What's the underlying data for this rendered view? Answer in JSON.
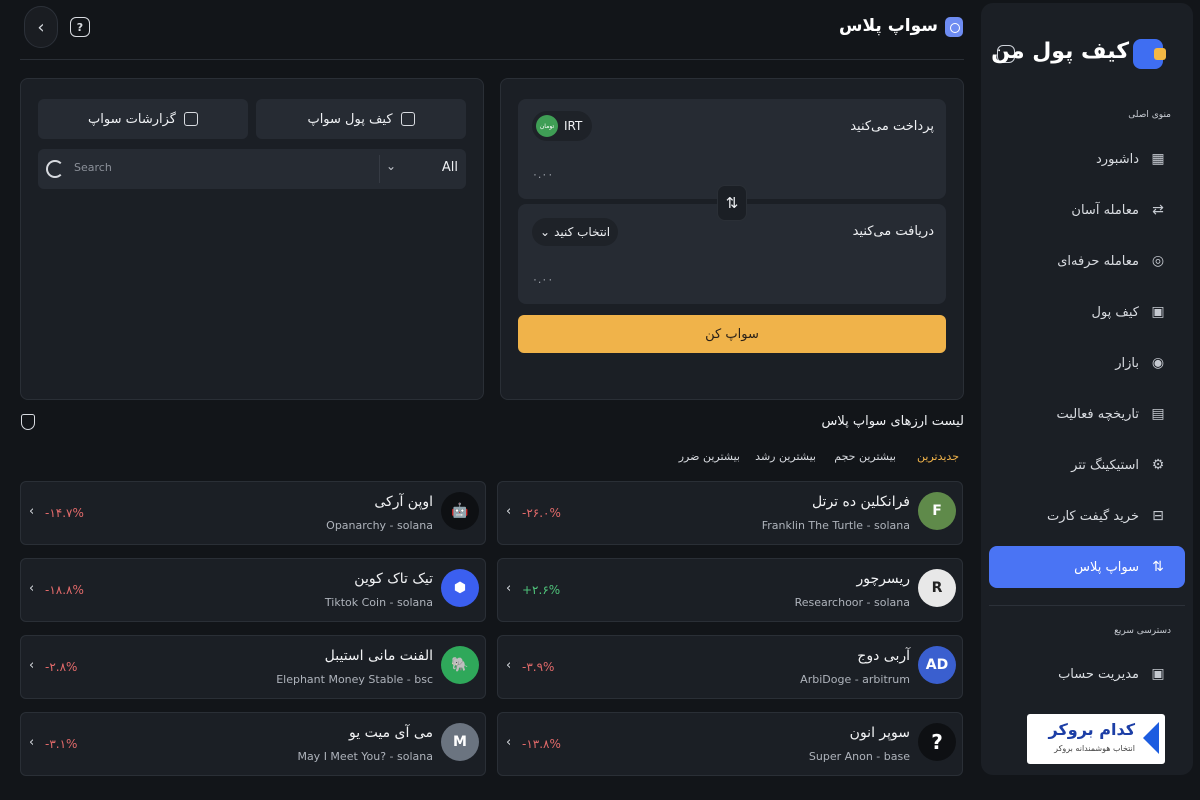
{
  "header": {
    "title": "سواپ پلاس",
    "back_icon": "chevron-left-icon",
    "help_icon": "help-chat-icon"
  },
  "sidebar": {
    "logo": "کیف پول من",
    "main_menu_title": "منوی اصلی",
    "items": [
      {
        "label": "داشبورد",
        "icon": "dashboard-grid-icon",
        "active": false
      },
      {
        "label": "معامله آسان",
        "icon": "easy-trade-icon",
        "active": false
      },
      {
        "label": "معامله حرفه‌ای",
        "icon": "pro-trade-icon",
        "active": false
      },
      {
        "label": "کیف پول",
        "icon": "wallet-icon",
        "active": false
      },
      {
        "label": "بازار",
        "icon": "market-icon",
        "active": false
      },
      {
        "label": "تاریخچه فعالیت",
        "icon": "history-icon",
        "active": false
      },
      {
        "label": "استیکینگ تتر",
        "icon": "staking-icon",
        "active": false
      },
      {
        "label": "خرید گیفت کارت",
        "icon": "gift-card-icon",
        "active": false
      },
      {
        "label": "سواپ پلاس",
        "icon": "swap-icon",
        "active": true
      }
    ],
    "quick_access_title": "دسترسی سریع",
    "quick_items": [
      {
        "label": "مدیریت حساب",
        "icon": "account-icon"
      }
    ],
    "broker": {
      "name": "کدام بروکر",
      "subtitle": "انتخاب هوشمندانه بروکر"
    }
  },
  "left_panel": {
    "tab_wallet": "کیف پول سواپ",
    "tab_reports": "گزارشات سواپ",
    "search_placeholder": "Search",
    "filter_value": "All"
  },
  "swap": {
    "pay_label": "پرداخت می‌کنید",
    "pay_currency": "IRT",
    "pay_currency_flag": "تومان",
    "pay_amount": "۰.۰۰",
    "receive_label": "دریافت می‌کنید",
    "receive_select": "انتخاب کنید",
    "receive_amount": "۰.۰۰",
    "submit": "سواپ کن"
  },
  "list": {
    "title": "لیست ارزهای سواپ پلاس",
    "sort_tabs": [
      {
        "label": "جدیدترین",
        "active": true
      },
      {
        "label": "بیشترین حجم",
        "active": false
      },
      {
        "label": "بیشترین رشد",
        "active": false
      },
      {
        "label": "بیشترین ضرر",
        "active": false
      }
    ],
    "coins": [
      {
        "name": "فرانکلین ده ترتل",
        "sub": "Franklin The Turtle - solana",
        "change": "-۲۶.۰%",
        "trend": "neg",
        "color": "#5f8a4a",
        "initial": "F"
      },
      {
        "name": "اوپن آرکی",
        "sub": "Opanarchy - solana",
        "change": "-۱۴.۷%",
        "trend": "neg",
        "color": "#0e1013",
        "initial": "🤖"
      },
      {
        "name": "ریسرچور",
        "sub": "Researchoor - solana",
        "change": "+۲.۶%",
        "trend": "pos",
        "color": "#e8e8e8",
        "initial": "R"
      },
      {
        "name": "تیک تاک کوین",
        "sub": "Tiktok Coin - solana",
        "change": "-۱۸.۸%",
        "trend": "neg",
        "color": "#3b5ff0",
        "initial": "⬢"
      },
      {
        "name": "آربی دوج",
        "sub": "ArbiDoge - arbitrum",
        "change": "-۳.۹%",
        "trend": "neg",
        "color": "#3a5fcf",
        "initial": "AD"
      },
      {
        "name": "الفنت مانی استیبل",
        "sub": "Elephant Money Stable - bsc",
        "change": "-۲.۸%",
        "trend": "neg",
        "color": "#2fa85a",
        "initial": "🐘"
      },
      {
        "name": "سوپر انون",
        "sub": "Super Anon - base",
        "change": "-۱۳.۸%",
        "trend": "neg",
        "color": "#0e1013",
        "initial": "?"
      },
      {
        "name": "می آی میت یو",
        "sub": "May I Meet You? - solana",
        "change": "-۳.۱%",
        "trend": "neg",
        "color": "#6b7480",
        "initial": "M"
      }
    ]
  }
}
